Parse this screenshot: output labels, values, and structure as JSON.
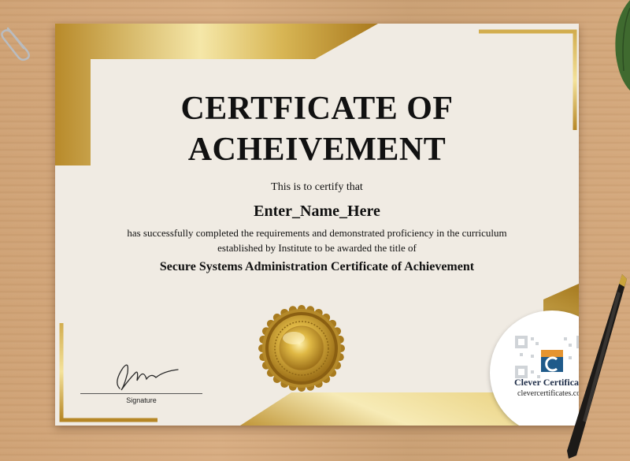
{
  "certificate": {
    "title_line1": "CERTFICATE OF",
    "title_line2": "ACHEIVEMENT",
    "certify_text": "This is to certify that",
    "recipient_name": "Enter_Name_Here",
    "body_line1": "has successfully completed the requirements and demonstrated proficiency in the curriculum",
    "body_line2": "established by Institute to be awarded the title of",
    "award_title": "Secure Systems Administration Certificate of Achievement",
    "signature_label": "Signature"
  },
  "badge": {
    "brand": "Clever Certificates",
    "url": "clevercertificates.com"
  },
  "colors": {
    "gold": "#c9a43c",
    "gold_light": "#f3e3a0",
    "paper": "#f0ebe3",
    "brand_blue": "#1f5a8a",
    "brand_orange": "#e59430"
  },
  "icons": [
    "paperclip-icon",
    "gold-seal-icon",
    "signature-scribble-icon",
    "qr-code-icon",
    "clever-logo-icon",
    "pen-icon",
    "leaf-icon"
  ]
}
